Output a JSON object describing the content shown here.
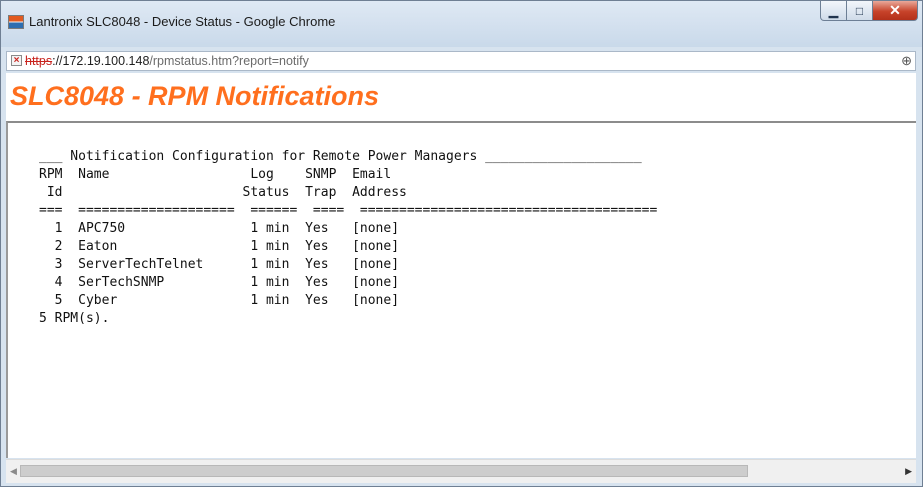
{
  "window": {
    "title": "Lantronix SLC8048 - Device Status - Google Chrome",
    "controls": {
      "minimize": "▁",
      "maximize": "□",
      "close": "✕"
    }
  },
  "address_bar": {
    "scheme": "https",
    "rest_host": "://172.19.100.148",
    "path": "/rpmstatus.htm?report=notify",
    "icons": [
      "insecure-lock-icon",
      "zoom-icon"
    ]
  },
  "page": {
    "title": "SLC8048 - RPM Notifications",
    "colors": {
      "title": "#ff6f1e",
      "insecure": "#c8231d"
    }
  },
  "report": {
    "heading_line": "___ Notification Configuration for Remote Power Managers ____________________",
    "header_line_1": "RPM  Name                  Log    SNMP  Email",
    "header_line_2": " Id                       Status  Trap  Address",
    "separator_line": "===  ====================  ======  ====  ======================================",
    "rows": [
      {
        "line": "  1  APC750                1 min  Yes   [none]"
      },
      {
        "line": "  2  Eaton                 1 min  Yes   [none]"
      },
      {
        "line": "  3  ServerTechTelnet      1 min  Yes   [none]"
      },
      {
        "line": "  4  SerTechSNMP           1 min  Yes   [none]"
      },
      {
        "line": "  5  Cyber                 1 min  Yes   [none]"
      }
    ],
    "footer_line": "5 RPM(s)."
  }
}
